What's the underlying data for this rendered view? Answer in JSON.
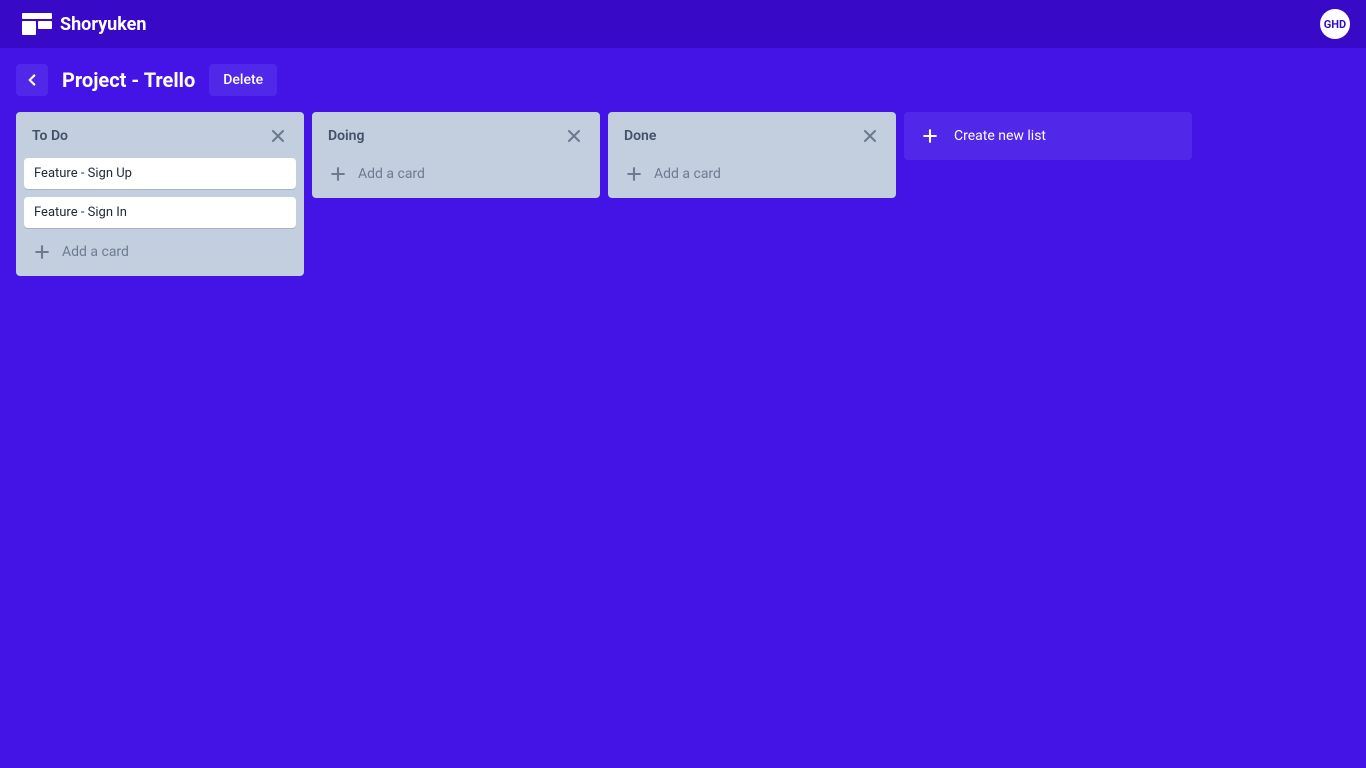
{
  "header": {
    "brand": "Shoryuken",
    "avatar_initials": "GHD"
  },
  "board_header": {
    "title": "Project - Trello",
    "delete_label": "Delete"
  },
  "lists": [
    {
      "title": "To Do",
      "cards": [
        {
          "title": "Feature - Sign Up"
        },
        {
          "title": "Feature - Sign In"
        }
      ],
      "add_card_label": "Add a card"
    },
    {
      "title": "Doing",
      "cards": [],
      "add_card_label": "Add a card"
    },
    {
      "title": "Done",
      "cards": [],
      "add_card_label": "Add a card"
    }
  ],
  "create_list_label": "Create new list"
}
